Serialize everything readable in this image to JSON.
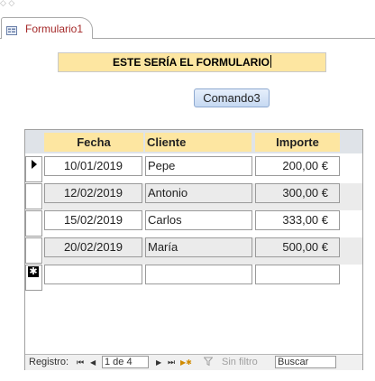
{
  "top_fragment": "◇ ◇",
  "tab": {
    "label": "Formulario1",
    "icon": "form-icon"
  },
  "form": {
    "header_text": "ESTE SERÍA EL FORMULARIO",
    "button_label": "Comando3"
  },
  "columns": [
    "Fecha",
    "Cliente",
    "Importe"
  ],
  "rows": [
    {
      "fecha": "10/01/2019",
      "cliente": "Pepe",
      "importe": "200,00 €"
    },
    {
      "fecha": "12/02/2019",
      "cliente": "Antonio",
      "importe": "300,00 €"
    },
    {
      "fecha": "15/02/2019",
      "cliente": "Carlos",
      "importe": "333,00 €"
    },
    {
      "fecha": "20/02/2019",
      "cliente": "María",
      "importe": "500,00 €"
    }
  ],
  "new_record_marker": "✱",
  "navigation": {
    "label": "Registro:",
    "first": "⏮",
    "prev": "◀",
    "position": "1 de 4",
    "next": "▶",
    "last": "⏭",
    "new": "▶✱",
    "filter_icon": "funnel-icon",
    "filter_label": "Sin filtro",
    "search": "Buscar"
  },
  "colors": {
    "header_fill": "#fde6a1",
    "tab_label": "#a52a2a",
    "alt_row": "#ebebeb"
  }
}
